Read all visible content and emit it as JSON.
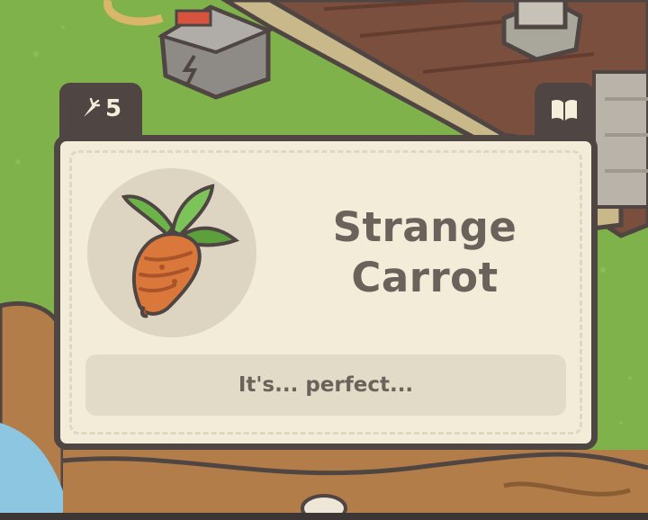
{
  "item_card": {
    "count": "5",
    "count_icon": "carrot-icon",
    "journal_icon": "book-icon",
    "item_image": "strange-carrot-icon",
    "title_line1": "Strange",
    "title_line2": "Carrot",
    "description": "It's... perfect..."
  },
  "colors": {
    "grass": "#7fb24a",
    "card_border": "#4f4542",
    "card_fill": "#f2ecd9",
    "title_text": "#6b625b",
    "carrot_orange": "#d9783a",
    "leaf_green": "#6cb44a"
  }
}
